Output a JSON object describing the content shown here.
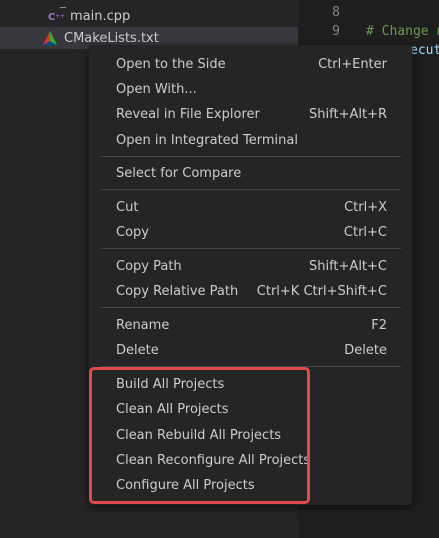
{
  "explorer": {
    "files": [
      {
        "name": "main.cpp",
        "icon": "cpp-file-icon",
        "icon_color": "#a074c4"
      },
      {
        "name": "CMakeLists.txt",
        "icon": "cmake-file-icon",
        "selected": true
      }
    ]
  },
  "editor": {
    "lines": [
      {
        "number": "8",
        "text": ""
      },
      {
        "number": "9",
        "text": "# Change n"
      },
      {
        "number": "",
        "text": "ecut"
      }
    ]
  },
  "context_menu": {
    "groups": [
      [
        {
          "label": "Open to the Side",
          "shortcut": "Ctrl+Enter"
        },
        {
          "label": "Open With...",
          "shortcut": ""
        },
        {
          "label": "Reveal in File Explorer",
          "shortcut": "Shift+Alt+R"
        },
        {
          "label": "Open in Integrated Terminal",
          "shortcut": ""
        }
      ],
      [
        {
          "label": "Select for Compare",
          "shortcut": ""
        }
      ],
      [
        {
          "label": "Cut",
          "shortcut": "Ctrl+X"
        },
        {
          "label": "Copy",
          "shortcut": "Ctrl+C"
        }
      ],
      [
        {
          "label": "Copy Path",
          "shortcut": "Shift+Alt+C"
        },
        {
          "label": "Copy Relative Path",
          "shortcut": "Ctrl+K Ctrl+Shift+C"
        }
      ],
      [
        {
          "label": "Rename",
          "shortcut": "F2"
        },
        {
          "label": "Delete",
          "shortcut": "Delete"
        }
      ],
      [
        {
          "label": "Build All Projects",
          "shortcut": ""
        },
        {
          "label": "Clean All Projects",
          "shortcut": ""
        },
        {
          "label": "Clean Rebuild All Projects",
          "shortcut": ""
        },
        {
          "label": "Clean Reconfigure All Projects",
          "shortcut": ""
        },
        {
          "label": "Configure All Projects",
          "shortcut": ""
        }
      ]
    ]
  },
  "colors": {
    "highlight_box": "#e04a4a",
    "menu_bg": "#252526",
    "separator": "#454545"
  }
}
